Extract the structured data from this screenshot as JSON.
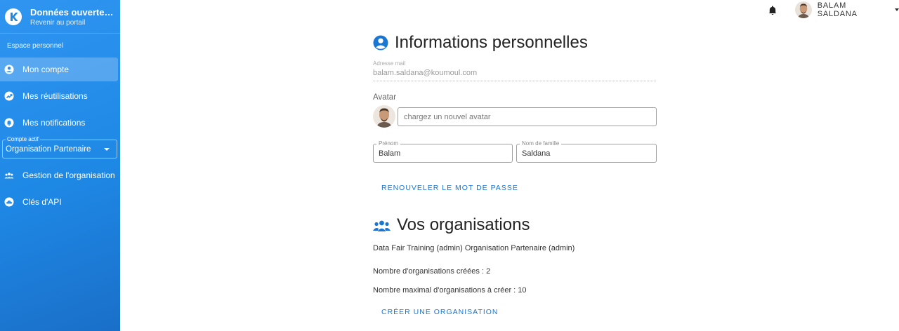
{
  "sidebar": {
    "brand_title": "Données ouvertes de r...",
    "brand_subtitle": "Revenir au portail",
    "section_label": "Espace personnel",
    "items": [
      {
        "label": "Mon compte",
        "icon": "account-circle-icon"
      },
      {
        "label": "Mes réutilisations",
        "icon": "trending-icon"
      },
      {
        "label": "Mes notifications",
        "icon": "bell-icon"
      },
      {
        "label": "Gestion de l'organisation",
        "icon": "groups-icon"
      },
      {
        "label": "Clés d'API",
        "icon": "cloud-icon"
      }
    ],
    "account_select": {
      "legend": "Compte actif",
      "value": "Organisation Partenaire"
    }
  },
  "topbar": {
    "user_name": "BALAM SALDANA"
  },
  "profile": {
    "title": "Informations personnelles",
    "email_label": "Adresse mail",
    "email_value": "balam.saldana@koumoul.com",
    "avatar_label": "Avatar",
    "avatar_upload_placeholder": "chargez un nouvel avatar",
    "firstname_label": "Prénom",
    "firstname_value": "Balam",
    "lastname_label": "Nom de famille",
    "lastname_value": "Saldana",
    "reset_password_label": "RENOUVELER LE MOT DE PASSE"
  },
  "organizations": {
    "title": "Vos organisations",
    "list_text": "Data Fair Training (admin) Organisation Partenaire (admin)",
    "created_count_text": "Nombre d'organisations créées : 2",
    "max_count_text": "Nombre maximal d'organisations à créer : 10",
    "create_label": "CRÉER UNE ORGANISATION"
  },
  "colors": {
    "sidebar_blue": "#1e88e5",
    "accent": "#1976d2"
  }
}
